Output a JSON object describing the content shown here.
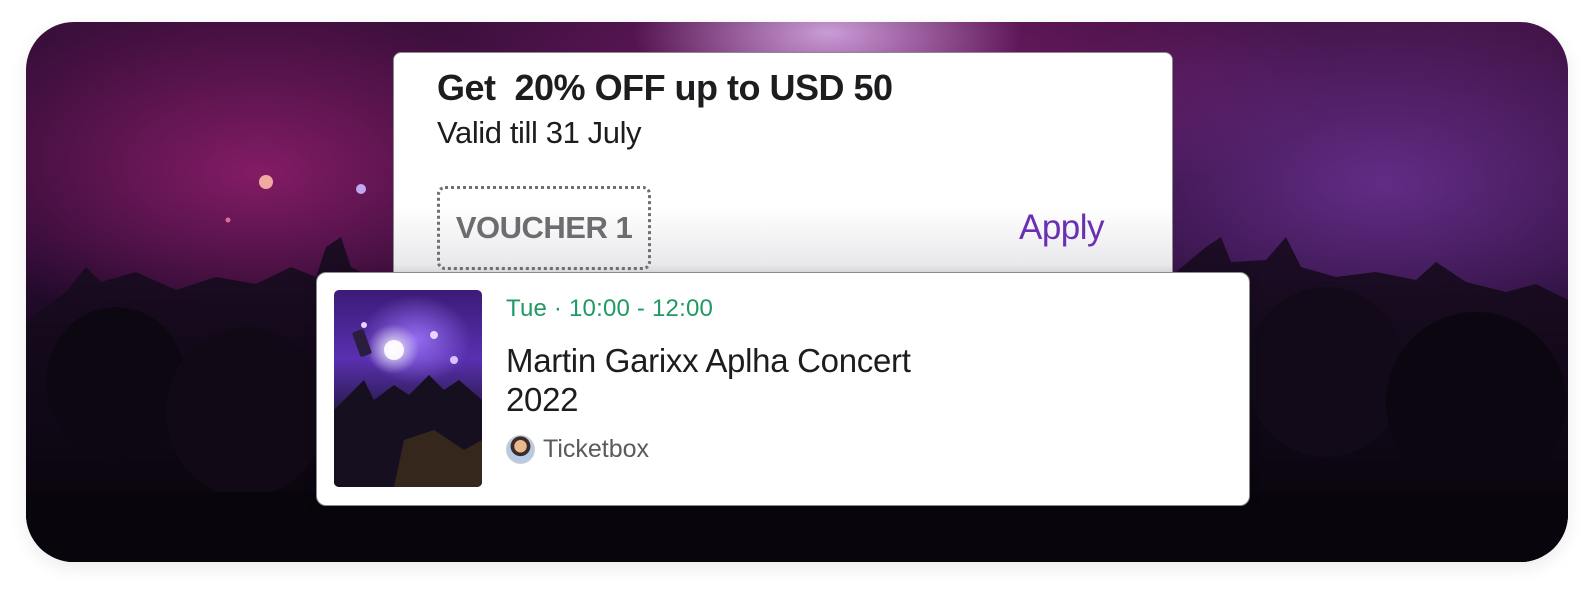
{
  "voucher": {
    "title": "Get  20% OFF up to USD 50",
    "valid": "Valid till 31 July",
    "code": "VOUCHER 1",
    "apply_label": "Apply",
    "accent_color": "#6a2fb3"
  },
  "event": {
    "time": "Tue · 10:00 - 12:00",
    "title": "Martin Garixx Aplha Concert 2022",
    "organizer": "Ticketbox",
    "time_color": "#1f9a62"
  }
}
